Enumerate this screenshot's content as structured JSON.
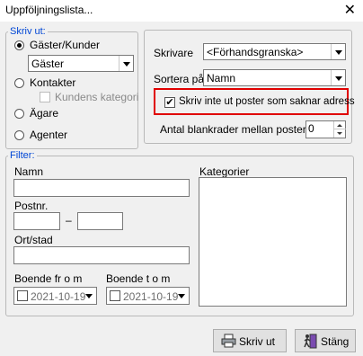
{
  "window": {
    "title": "Uppföljningslista..."
  },
  "print_group": {
    "legend": "Skriv ut:",
    "options": [
      "Gäster/Kunder",
      "Kontakter",
      "Ägare",
      "Agenter"
    ],
    "guest_select": "Gäster",
    "kundens_kategori": "Kundens kategori"
  },
  "printer": {
    "label": "Skrivare",
    "value": "<Förhandsgranska>",
    "sort_label": "Sortera på",
    "sort_value": "Namn",
    "skip_label": "Skriv inte ut poster som saknar adress",
    "blank_label": "Antal blankrader mellan posterna",
    "blank_value": "0"
  },
  "filter": {
    "legend": "Filter:",
    "name_label": "Namn",
    "postnr_label": "Postnr.",
    "dash": "–",
    "ort_label": "Ort/stad",
    "from_label": "Boende fr o m",
    "to_label": "Boende t o m",
    "from_date": "2021-10-19",
    "to_date": "2021-10-19",
    "kategorier_label": "Kategorier"
  },
  "buttons": {
    "print": "Skriv ut",
    "close": "Stäng"
  },
  "colors": {
    "legend": "#0046d5",
    "highlight": "#e00000"
  }
}
